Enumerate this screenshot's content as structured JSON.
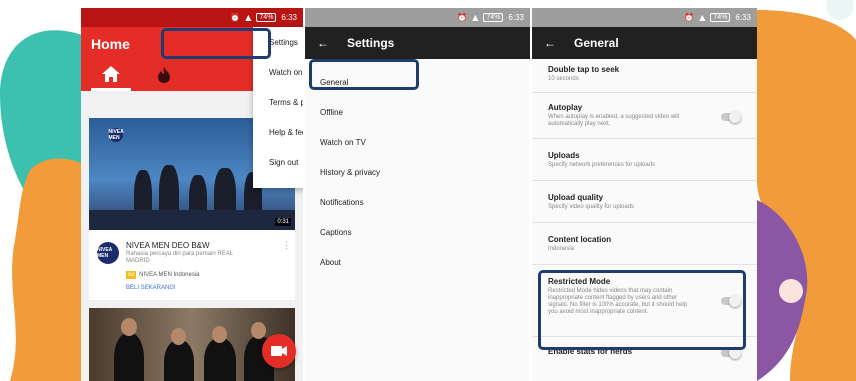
{
  "colors": {
    "teal": "#3cc1b0",
    "orange": "#f29b3b",
    "purple": "#8b57a4",
    "youtube_red": "#e52d27",
    "highlight": "#1f3c6e"
  },
  "status_bar": {
    "time": "6:33",
    "battery": "74%"
  },
  "screen1": {
    "app_title": "Home",
    "menu": [
      "Settings",
      "Watch on TV",
      "Terms & privacy policy",
      "Help & feedback",
      "Sign out"
    ],
    "video1": {
      "duration": "0:31",
      "channel_badge": "NIVEA MEN",
      "title": "NIVEA MEN DEO B&W",
      "description": "Rahasia percaya diri para pemain REAL MADRID",
      "ad_label": "Ad",
      "advertiser": "NIVEA MEN Indonesia",
      "cta": "BELI SEKARANG!"
    }
  },
  "screen2": {
    "title": "Settings",
    "items": [
      "General",
      "Offline",
      "Watch on TV",
      "History & privacy",
      "Notifications",
      "Captions",
      "About"
    ]
  },
  "screen3": {
    "title": "General",
    "items": [
      {
        "label": "Double tap to seek",
        "sub": "10 seconds"
      },
      {
        "label": "Autoplay",
        "sub": "When autoplay is enabled, a suggested video will automatically play next."
      },
      {
        "label": "Uploads",
        "sub": "Specify network preferences for uploads"
      },
      {
        "label": "Upload quality",
        "sub": "Specify video quality for uploads"
      },
      {
        "label": "Content location",
        "sub": "Indonesia"
      },
      {
        "label": "Restricted Mode",
        "sub": "Restricted Mode hides videos that may contain inappropriate content flagged by users and other signals. No filter is 100% accurate, but it should help you avoid most inappropriate content."
      },
      {
        "label": "Enable stats for nerds",
        "sub": ""
      }
    ]
  }
}
